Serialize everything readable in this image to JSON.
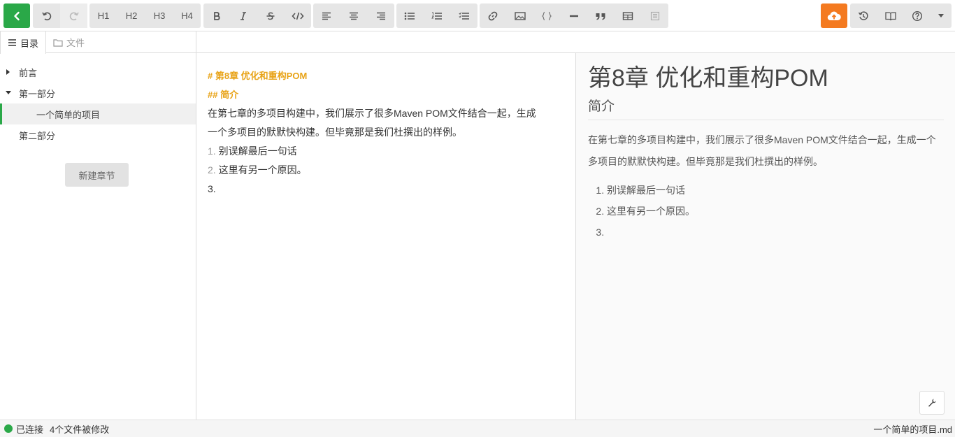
{
  "toolbar": {
    "headings": [
      "H1",
      "H2",
      "H3",
      "H4"
    ]
  },
  "sidebar": {
    "tabs": [
      {
        "label": "目录",
        "icon": "list-icon"
      },
      {
        "label": "文件",
        "icon": "folder-icon"
      }
    ],
    "items": [
      {
        "label": "前言"
      },
      {
        "label": "第一部分"
      },
      {
        "label": "一个简单的项目"
      },
      {
        "label": "第二部分"
      }
    ],
    "new_chapter": "新建章节"
  },
  "editor": {
    "h1": "# 第8章 优化和重构POM",
    "h2": "## 简介",
    "para_line1": "在第七章的多项目构建中，我们展示了很多Maven POM文件结合一起，生成",
    "para_line2": "一个多项目的默默快构建。但毕竟那是我们杜撰出的样例。",
    "list": [
      {
        "num": "1.",
        "text": " 别误解最后一句话"
      },
      {
        "num": "2.",
        "text": " 这里有另一个原因。"
      },
      {
        "num": "3.",
        "text": ""
      }
    ]
  },
  "preview": {
    "title": "第8章 优化和重构POM",
    "subtitle": "简介",
    "paragraph": "在第七章的多项目构建中，我们展示了很多Maven POM文件结合一起，生成一个多项目的默默快构建。但毕竟那是我们杜撰出的样例。",
    "list": [
      "别误解最后一句话",
      "这里有另一个原因。",
      ""
    ]
  },
  "status": {
    "connection": "已连接",
    "modified": "4个文件被修改",
    "current_file": "一个简单的项目.md"
  },
  "colors": {
    "accent_green": "#2aa848",
    "accent_orange": "#f47a20",
    "heading_markdown": "#e8a317"
  }
}
